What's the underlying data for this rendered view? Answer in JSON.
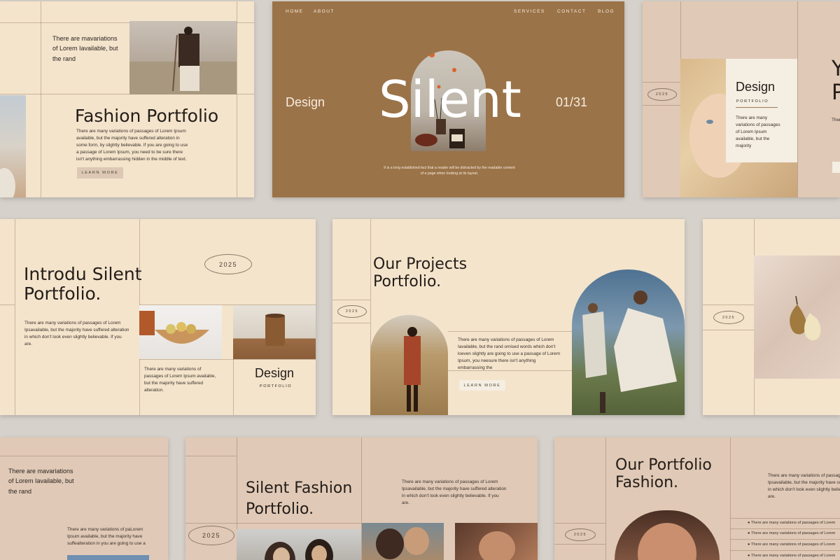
{
  "colors": {
    "page_bg": "#d6d1ca",
    "cream": "#f4e4cc",
    "rose": "#e0c9b6",
    "brown": "#9b7348",
    "ink": "#231d19"
  },
  "s1": {
    "intro": "There are mavariations of Lorem Iavailable, but the rand",
    "title": "Fashion Portfolio",
    "body": "There are many variations of passages of Lorem Ipsum available, but the majority have suffered alteration in some form, by slightly believable. If you are going to use a passage of Lorem Ipsum, you need to be sure there isn't anything embarrassing hidden in the middle of text.",
    "button": "LEARN MORE"
  },
  "s2": {
    "nav_left": [
      "HOME",
      "ABOUT"
    ],
    "nav_right": [
      "SERVICES",
      "CONTACT",
      "BLOG"
    ],
    "left_word": "Design",
    "title": "Silent",
    "page": "01/31",
    "caption": "It is a long established fact that a reader will be distracted by the readable content of a page when looking at its layout."
  },
  "s3": {
    "year": "2025",
    "title": "Design",
    "sub": "PORTFOLIO",
    "body": "There are many variations of passages of Lorem Ipsum available, but the majority",
    "side_letters": "Y\nP",
    "side_body": "There"
  },
  "s4": {
    "title": "Introdu Silent Portfolio.",
    "year": "2025",
    "body": "There are many variations of passages of Lorem Ipsavailable, but the majority have suffered alteration in which don't look even slightly believable. If you are.",
    "body2": "There are many variations of passages of Lorem Ipsum available, but the majority have suffered alteration.",
    "design": "Design",
    "sub": "PORTFOLIO"
  },
  "s5": {
    "title": "Our Projects Portfolio.",
    "year": "2025",
    "body": "There are many variations of passages of Lorem Iavailable, but the rand omised words which don't loeven slightly are going to use a passage of Lorem Ipsum, you neesure there isn't anything embarrassing the",
    "button": "LEARN MORE"
  },
  "s6": {
    "year": "2025"
  },
  "s7": {
    "intro": "There are mavariations of Lorem Iavailable, but the rand",
    "body": "There are many variations of paLorem Ipsum available, but the majority have suffealteration in you are going to use a"
  },
  "s8": {
    "title": "Silent Fashion Portfolio.",
    "year": "2025",
    "body": "There are many variations of passages of Lorem Ipsavailable, but the majority have suffered alteration in which don't look even slightly believable. If you are."
  },
  "s9": {
    "title": "Our Portfolio Fashion.",
    "year": "2025",
    "body": "There are many variations of passages of Lorem Ipsavailable, but the majority have suffered alteration in which don't look even slightly believable. If you are.",
    "list": [
      "There are many variations of passages of Lorem",
      "There are many variations of passages of Lorem",
      "There are many variations of passages of Lorem",
      "There are many variations of passages of Lorem"
    ]
  }
}
